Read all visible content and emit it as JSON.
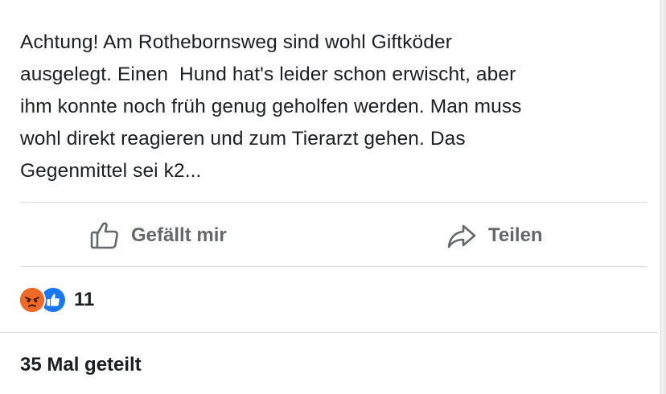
{
  "post": {
    "text_lines": [
      "Achtung! Am Rothebornsweg sind wohl Giftköder",
      "ausgelegt. Einen  Hund hat's leider schon erwischt, aber",
      "ihm konnte noch früh genug geholfen werden. Man muss",
      "wohl direkt reagieren und zum Tierarzt gehen. Das",
      "Gegenmittel sei k2..."
    ]
  },
  "actions": {
    "like_label": "Gefällt mir",
    "share_label": "Teilen",
    "like_icon": "thumbs-up-outline-icon",
    "share_icon": "share-arrow-icon"
  },
  "reactions": {
    "types": [
      "angry-reaction-icon",
      "like-reaction-icon"
    ],
    "count": "11"
  },
  "shares": {
    "label": "35 Mal geteilt"
  },
  "colors": {
    "text": "#1c1e21",
    "secondary_text": "#65676b",
    "divider": "#d9dadc",
    "like_blue": "#1877f2",
    "angry_orange": "#ec6a2a"
  }
}
